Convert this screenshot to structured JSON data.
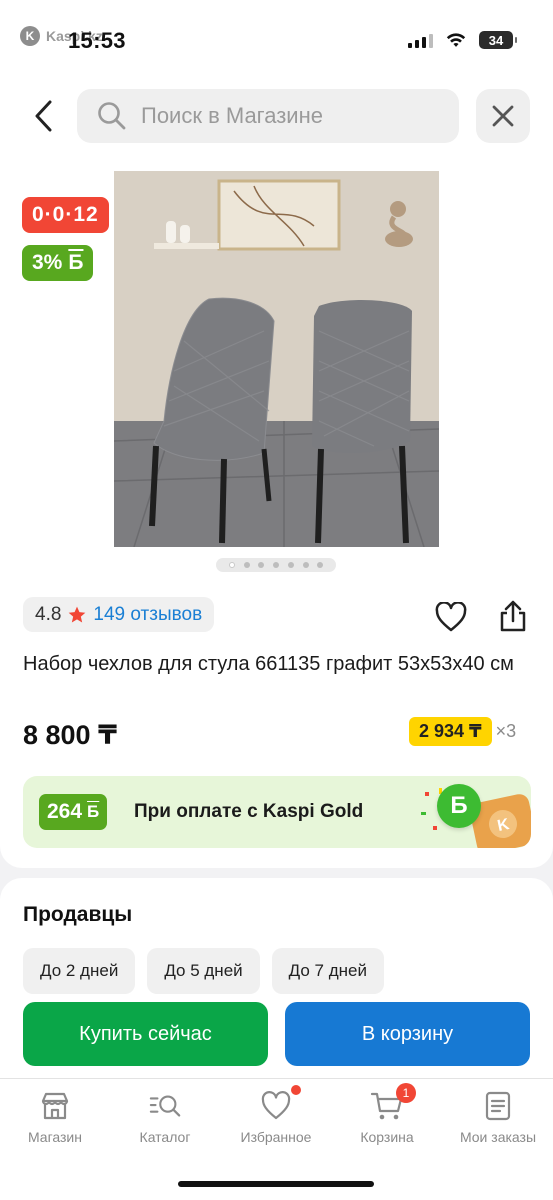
{
  "status_bar": {
    "app_name": "Kaspi.kz",
    "time": "15:53",
    "battery": "34"
  },
  "search": {
    "placeholder": "Поиск в Магазине"
  },
  "badges": {
    "timer": "0·0·12",
    "bonus_percent": "3%",
    "bonus_symbol": "Б"
  },
  "gallery": {
    "total_images": 7,
    "active_index": 0
  },
  "rating": {
    "value": "4.8",
    "reviews": "149 отзывов"
  },
  "product": {
    "title": "Набор чехлов для стула 661135 графит 53x53x40 см",
    "price": "8 800 ₸",
    "installment_amount": "2 934 ₸",
    "installment_multiplier": "×3"
  },
  "kaspi_gold": {
    "bonus_amount": "264",
    "bonus_symbol": "Б",
    "text": "При оплате с Kaspi Gold",
    "coin_symbol": "Б"
  },
  "sellers": {
    "title": "Продавцы",
    "delivery_filters": [
      "До 2 дней",
      "До 5 дней",
      "До 7 дней"
    ]
  },
  "actions": {
    "buy_now": "Купить сейчас",
    "add_to_cart": "В корзину"
  },
  "tabbar": {
    "items": [
      {
        "label": "Магазин",
        "icon": "store-icon"
      },
      {
        "label": "Каталог",
        "icon": "catalog-search-icon"
      },
      {
        "label": "Избранное",
        "icon": "heart-icon"
      },
      {
        "label": "Корзина",
        "icon": "cart-icon",
        "badge": "1"
      },
      {
        "label": "Мои заказы",
        "icon": "orders-icon"
      }
    ]
  },
  "colors": {
    "accent_red": "#f14635",
    "bonus_green": "#58a81f",
    "buy_green": "#0aa648",
    "cart_blue": "#1779d3",
    "installment_yellow": "#ffd400",
    "link_blue": "#1a7fd4"
  }
}
